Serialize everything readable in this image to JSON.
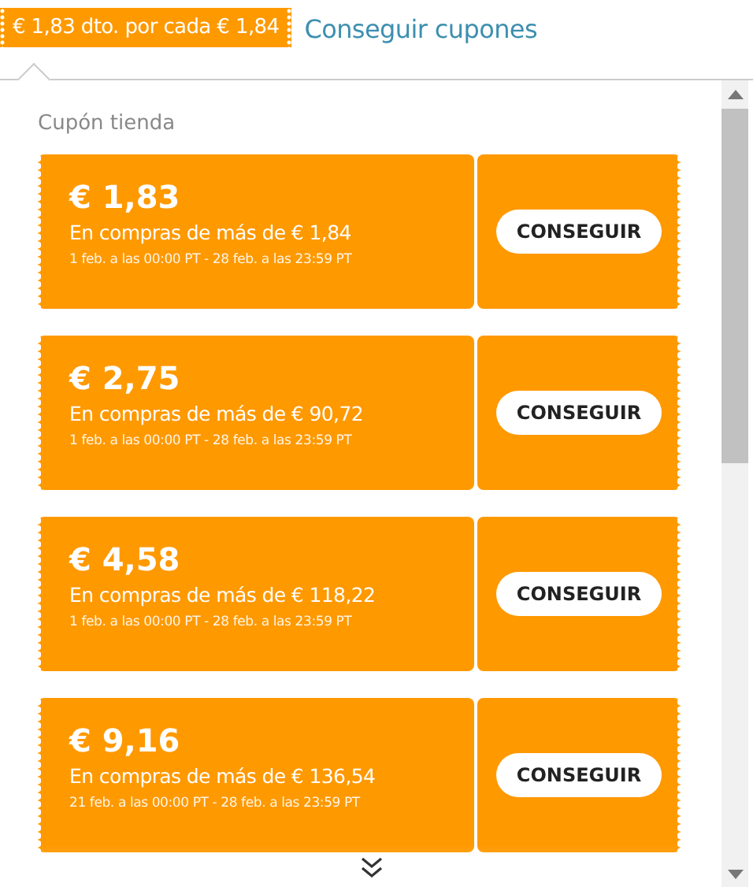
{
  "badge": "€ 1,83 dto. por cada € 1,84",
  "link": "Conseguir cupones",
  "section_title": "Cupón tienda",
  "coupons": [
    {
      "amount": "€ 1,83",
      "condition": "En compras de más de € 1,84",
      "validity": "1 feb. a las 00:00 PT - 28 feb. a las 23:59 PT",
      "button": "CONSEGUIR"
    },
    {
      "amount": "€ 2,75",
      "condition": "En compras de más de € 90,72",
      "validity": "1 feb. a las 00:00 PT - 28 feb. a las 23:59 PT",
      "button": "CONSEGUIR"
    },
    {
      "amount": "€ 4,58",
      "condition": "En compras de más de € 118,22",
      "validity": "1 feb. a las 00:00 PT - 28 feb. a las 23:59 PT",
      "button": "CONSEGUIR"
    },
    {
      "amount": "€ 9,16",
      "condition": "En compras de más de € 136,54",
      "validity": "21 feb. a las 00:00 PT - 28 feb. a las 23:59 PT",
      "button": "CONSEGUIR"
    }
  ]
}
